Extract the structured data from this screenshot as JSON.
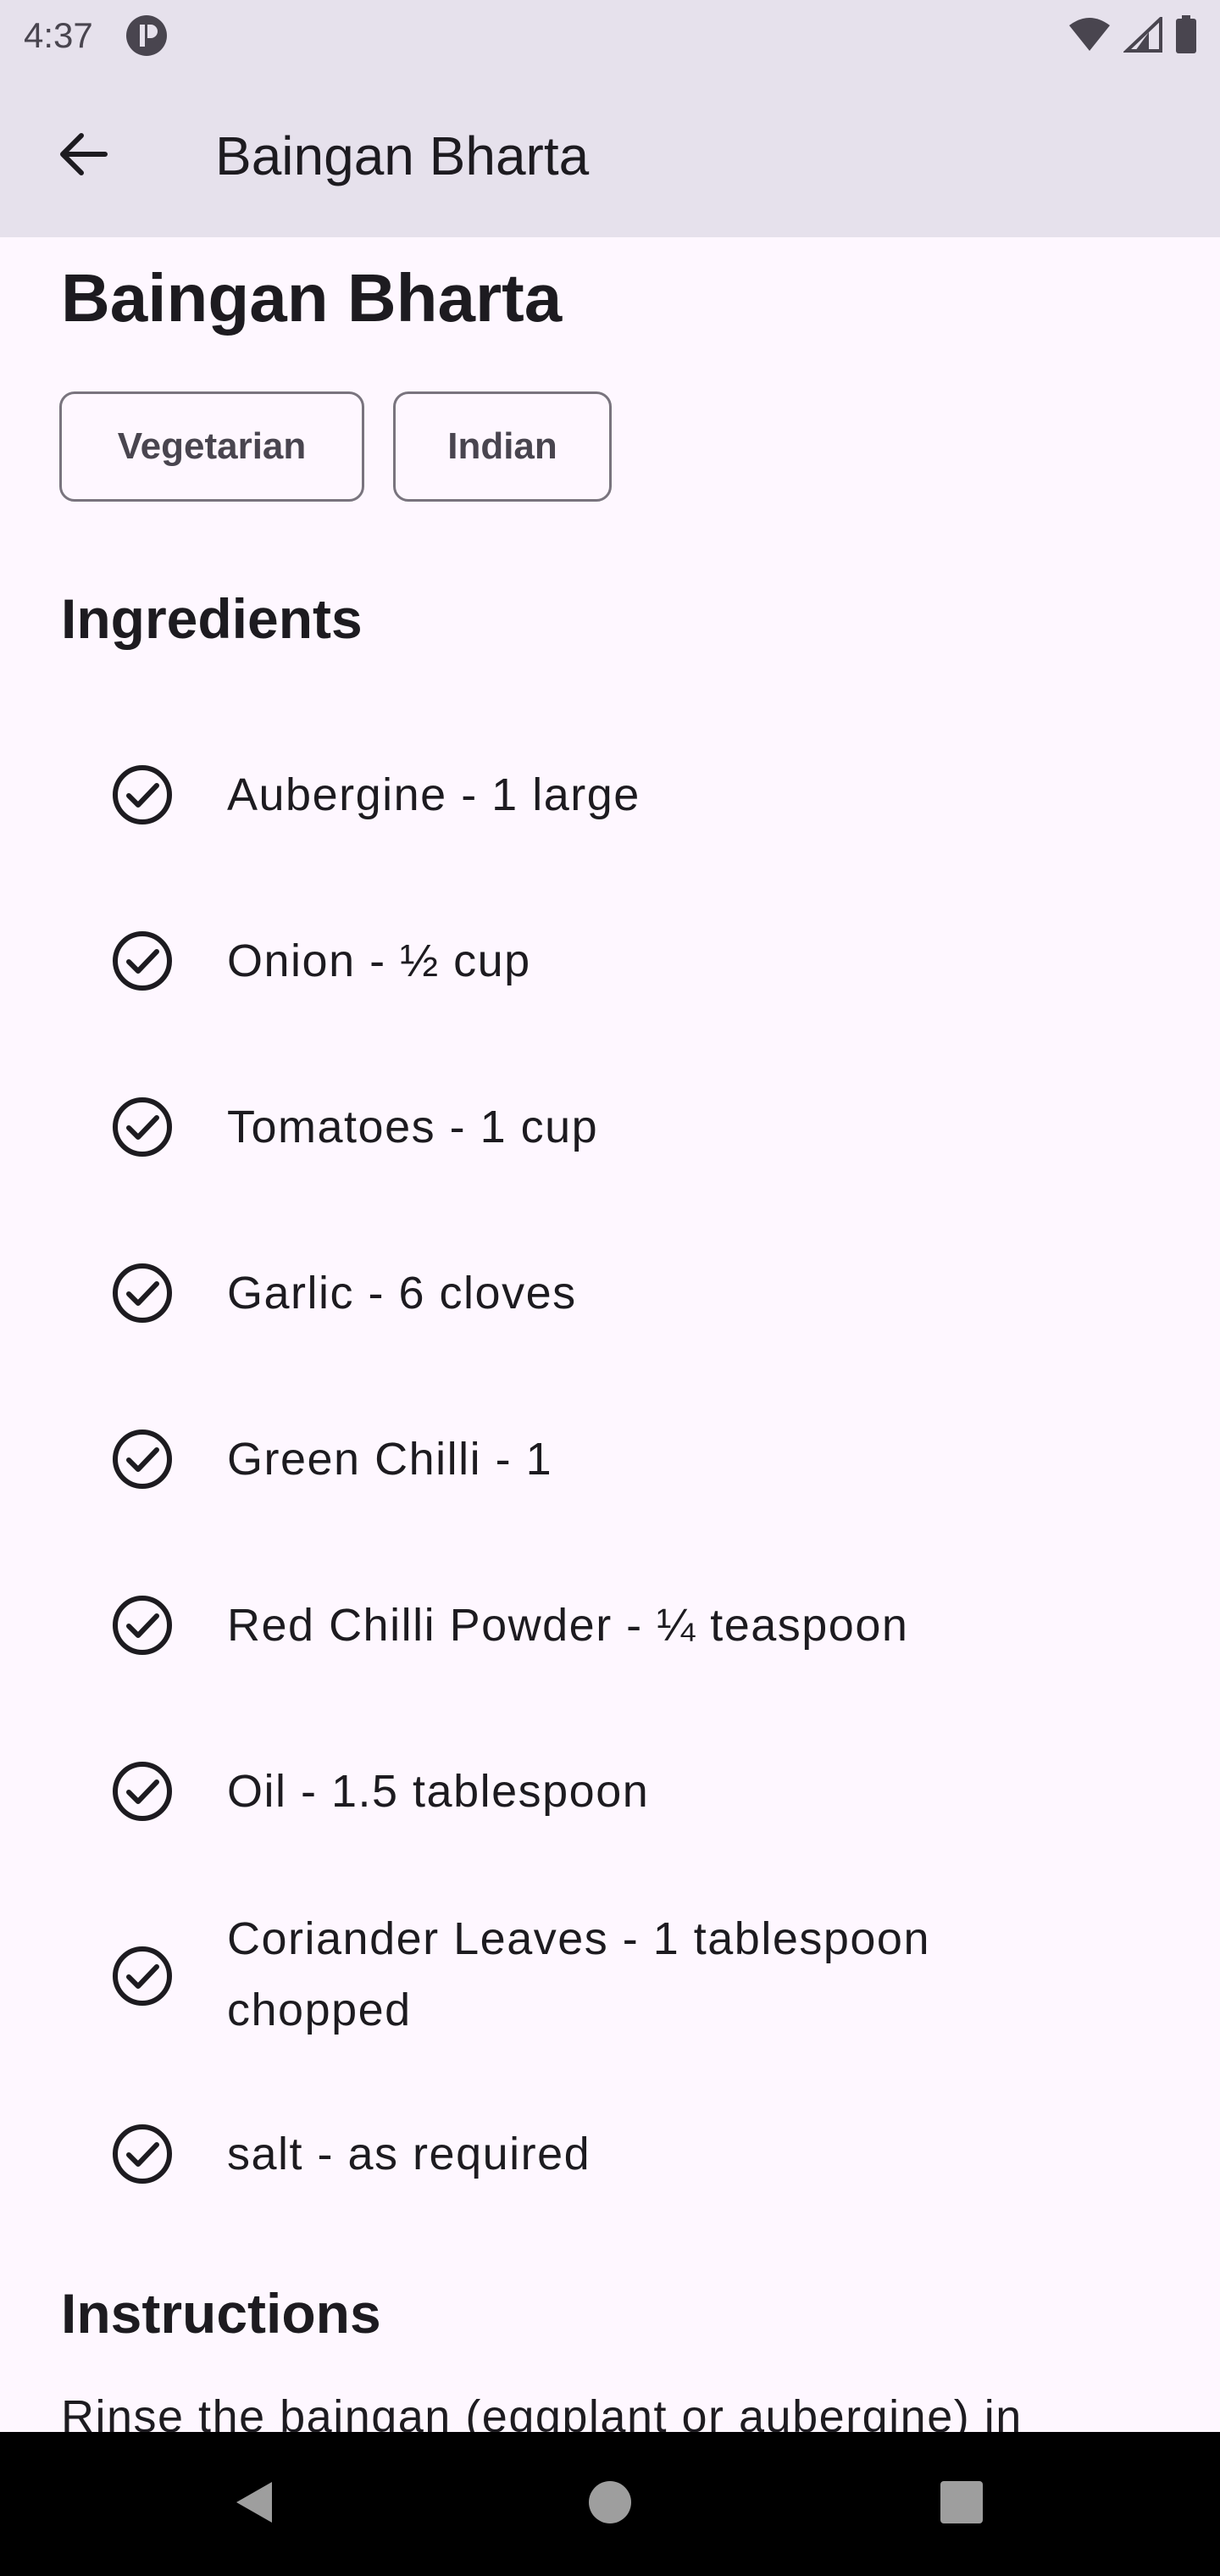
{
  "status_bar": {
    "time": "4:37",
    "icons": [
      "app-notification-icon",
      "wifi-icon",
      "signal-icon",
      "battery-icon"
    ]
  },
  "app_bar": {
    "title": "Baingan Bharta",
    "back_icon": "arrow-left-icon"
  },
  "recipe": {
    "title": "Baingan Bharta",
    "tags": [
      "Vegetarian",
      "Indian"
    ],
    "ingredients_heading": "Ingredients",
    "ingredients": [
      "Aubergine - 1 large",
      "Onion - ½ cup",
      "Tomatoes - 1 cup",
      "Garlic - 6 cloves",
      "Green Chilli - 1",
      "Red Chilli Powder - ¼ teaspoon",
      "Oil - 1.5 tablespoon",
      "Coriander Leaves - 1 tablespoon chopped",
      "salt - as required"
    ],
    "instructions_heading": "Instructions",
    "instructions_text": "Rinse the baingan (eggplant or aubergine) in"
  },
  "nav_bar": {
    "icons": [
      "nav-back-icon",
      "nav-home-icon",
      "nav-recents-icon"
    ]
  },
  "colors": {
    "background": "#fef7ff",
    "app_bar": "#e6e1ec",
    "text": "#1d1b20",
    "secondary_text": "#49454f",
    "outline": "#79747e"
  }
}
